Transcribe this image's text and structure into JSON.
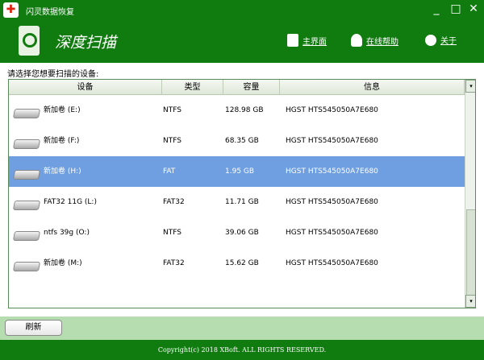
{
  "window": {
    "title": "闪灵数据恢复",
    "minimize": "_",
    "maximize": "□",
    "close": "✕"
  },
  "header": {
    "title": "深度扫描",
    "nav": [
      {
        "label": "主界面",
        "icon": "home-icon"
      },
      {
        "label": "在线帮助",
        "icon": "user-icon"
      },
      {
        "label": "关于",
        "icon": "smiley-icon"
      }
    ]
  },
  "prompt": "请选择您想要扫描的设备:",
  "table": {
    "columns": [
      "设备",
      "类型",
      "容量",
      "信息"
    ],
    "rows": [
      {
        "device": "新加卷 (E:)",
        "type": "NTFS",
        "capacity": "128.98 GB",
        "info": "HGST HTS545050A7E680",
        "selected": false
      },
      {
        "device": "新加卷 (F:)",
        "type": "NTFS",
        "capacity": "68.35 GB",
        "info": "HGST HTS545050A7E680",
        "selected": false
      },
      {
        "device": "新加卷 (H:)",
        "type": "FAT",
        "capacity": "1.95 GB",
        "info": "HGST HTS545050A7E680",
        "selected": true
      },
      {
        "device": "FAT32 11G (L:)",
        "type": "FAT32",
        "capacity": "11.71 GB",
        "info": "HGST HTS545050A7E680",
        "selected": false
      },
      {
        "device": "ntfs 39g (O:)",
        "type": "NTFS",
        "capacity": "39.06 GB",
        "info": "HGST HTS545050A7E680",
        "selected": false
      },
      {
        "device": "新加卷 (M:)",
        "type": "FAT32",
        "capacity": "15.62 GB",
        "info": "HGST HTS545050A7E680",
        "selected": false
      }
    ]
  },
  "refresh_label": "刷新",
  "footer": "Copyright(c) 2018 XBoft. ALL RIGHTS RESERVED."
}
